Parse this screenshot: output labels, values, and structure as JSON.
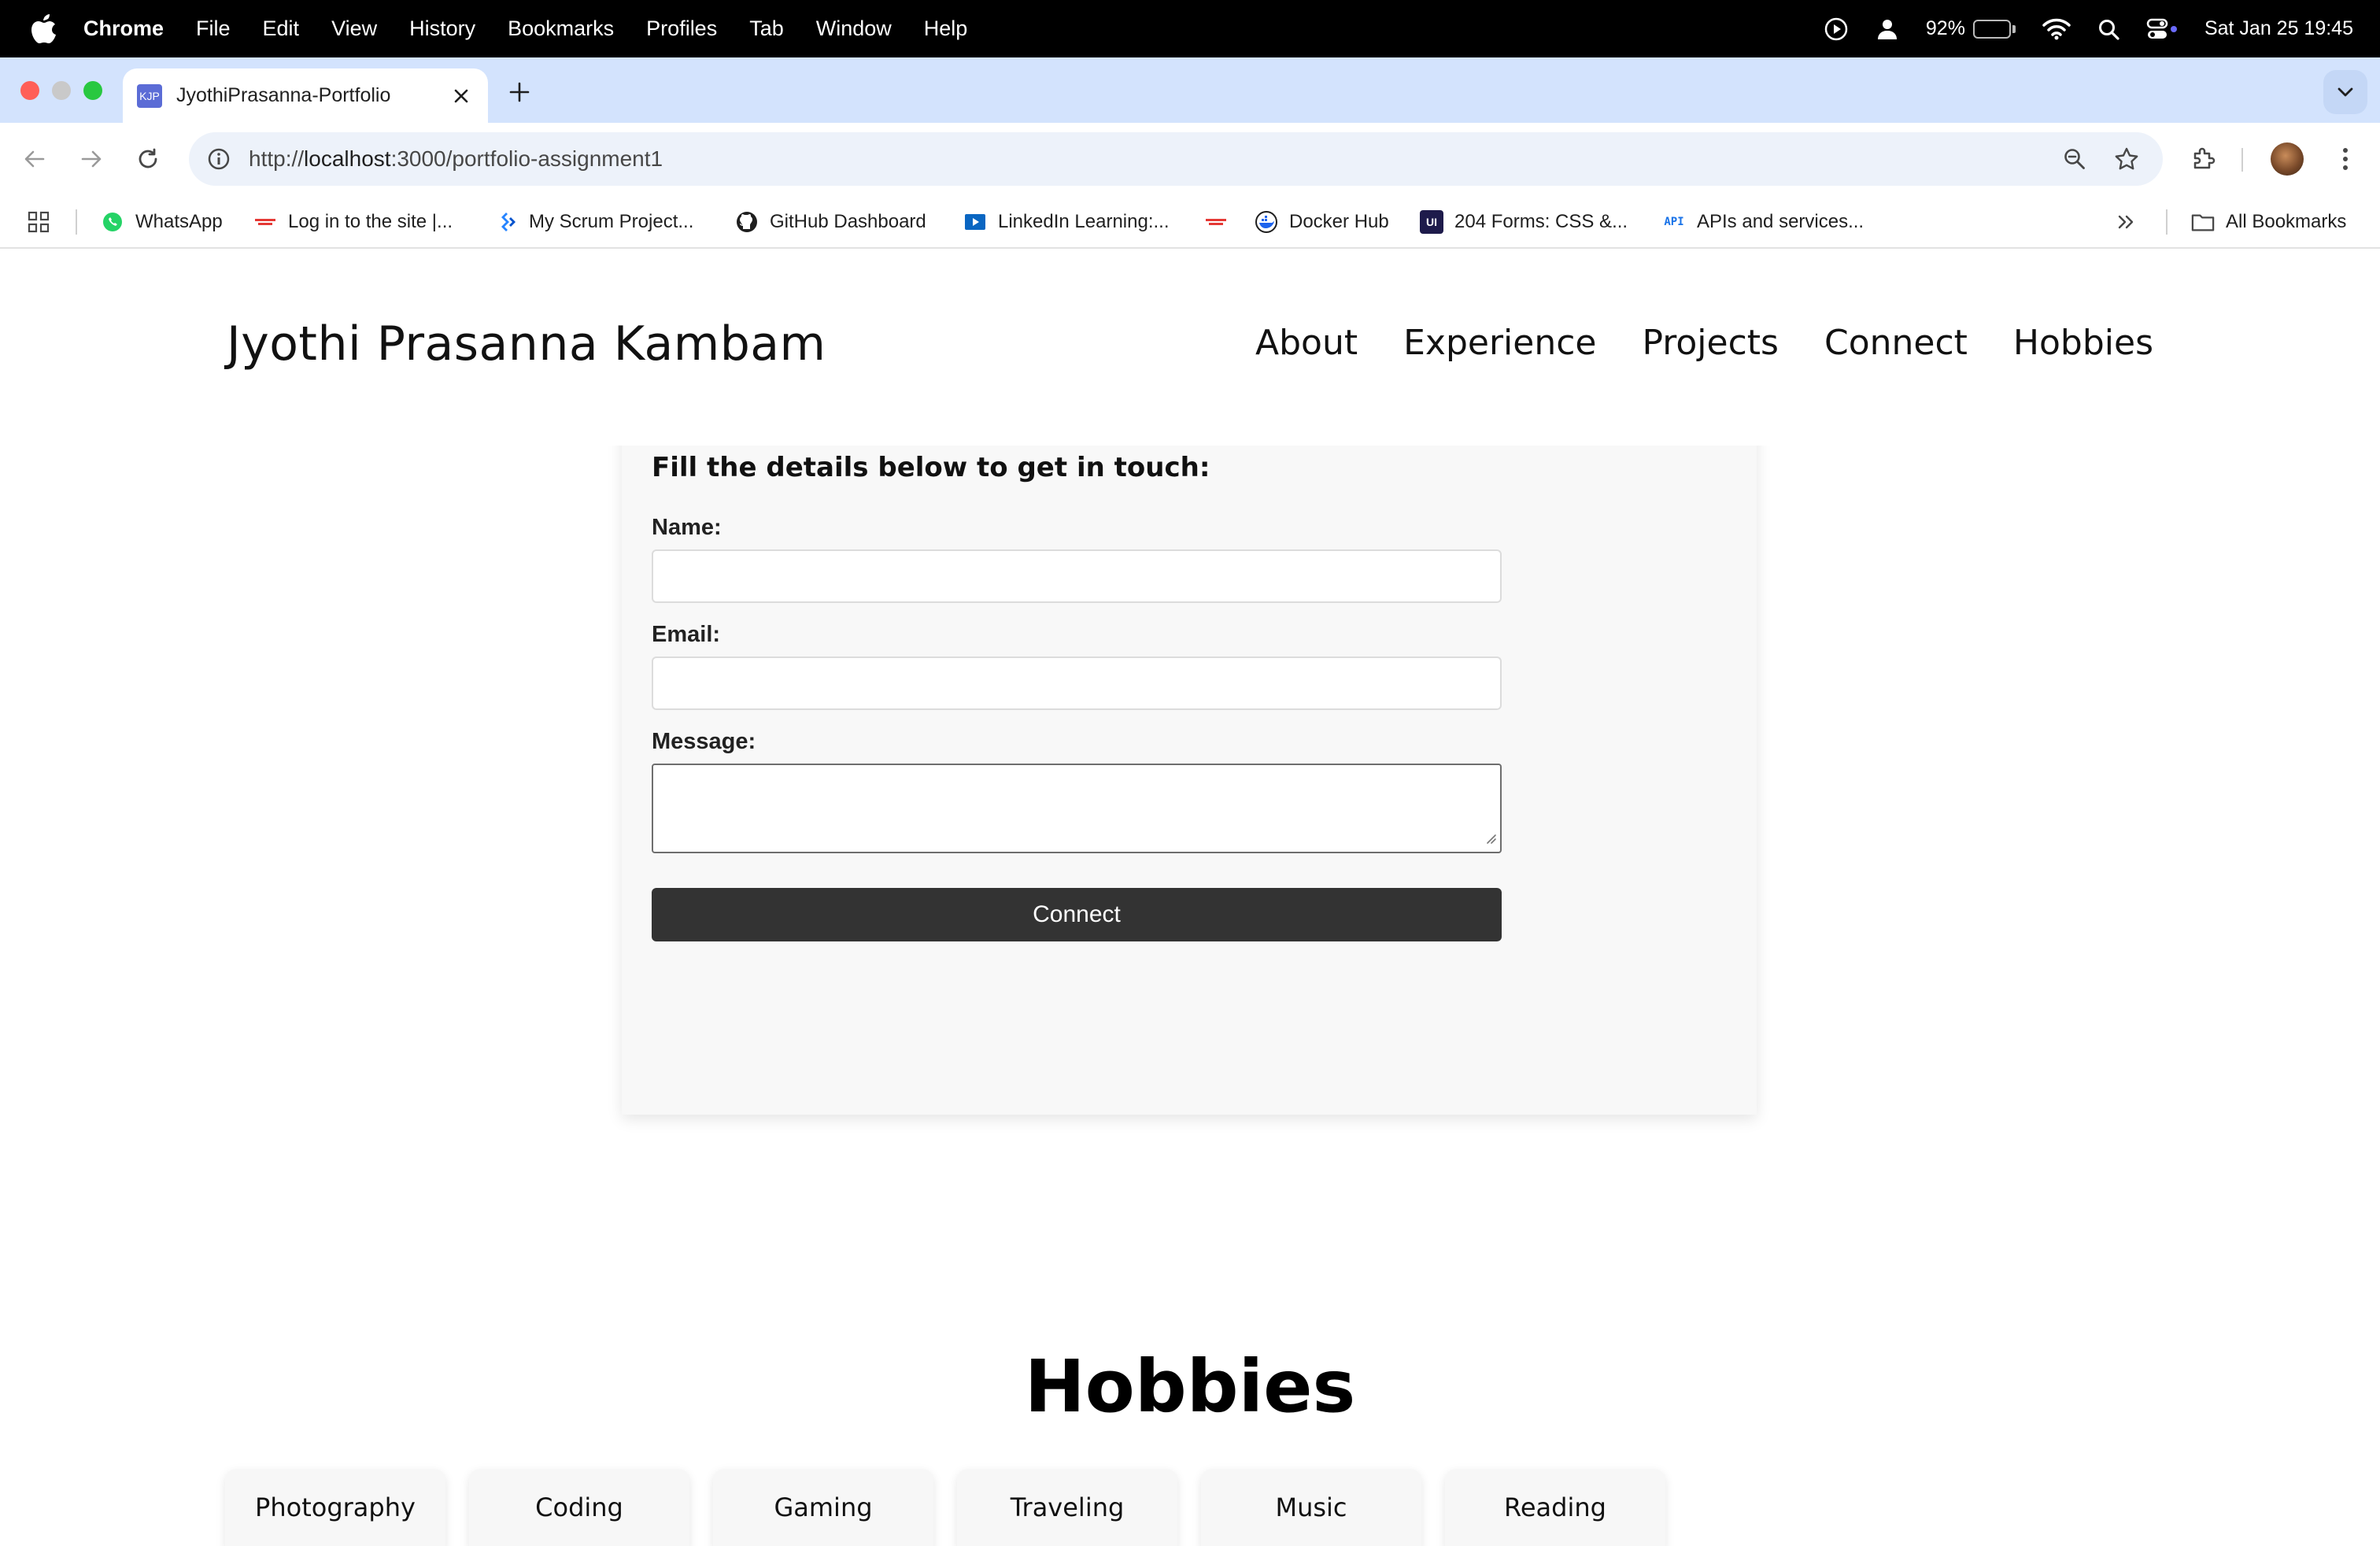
{
  "menubar": {
    "app": "Chrome",
    "items": [
      "File",
      "Edit",
      "View",
      "History",
      "Bookmarks",
      "Profiles",
      "Tab",
      "Window",
      "Help"
    ],
    "battery": "92%",
    "battery_level": 0.92,
    "datetime": "Sat Jan 25  19:45"
  },
  "tab": {
    "favicon_text": "KJP",
    "title": "JyothiPrasanna-Portfolio"
  },
  "omnibox": {
    "url_scheme": "http://",
    "url_host": "localhost",
    "url_rest": ":3000/portfolio-assignment1"
  },
  "bookmarks": {
    "items": [
      "WhatsApp",
      "Log in to the site |...",
      "My Scrum Project...",
      "GitHub Dashboard",
      "LinkedIn Learning:...",
      "",
      "Docker Hub",
      "204 Forms: CSS &...",
      "APIs and services..."
    ],
    "all_label": "All Bookmarks",
    "ui_badge": "UI",
    "api_badge": "API"
  },
  "site": {
    "name": "Jyothi Prasanna Kambam",
    "nav": [
      "About",
      "Experience",
      "Projects",
      "Connect",
      "Hobbies"
    ]
  },
  "form": {
    "title": "Fill the details below to get in touch:",
    "name_label": "Name:",
    "email_label": "Email:",
    "message_label": "Message:",
    "name_value": "",
    "email_value": "",
    "message_value": "",
    "submit_label": "Connect"
  },
  "hobbies": {
    "title": "Hobbies",
    "items": [
      "Photography",
      "Coding",
      "Gaming",
      "Traveling",
      "Music",
      "Reading"
    ]
  },
  "colors": {
    "tabstrip": "#d3e3fd",
    "omnibox": "#edf2fa",
    "button": "#333333",
    "card": "#f8f8f8"
  }
}
